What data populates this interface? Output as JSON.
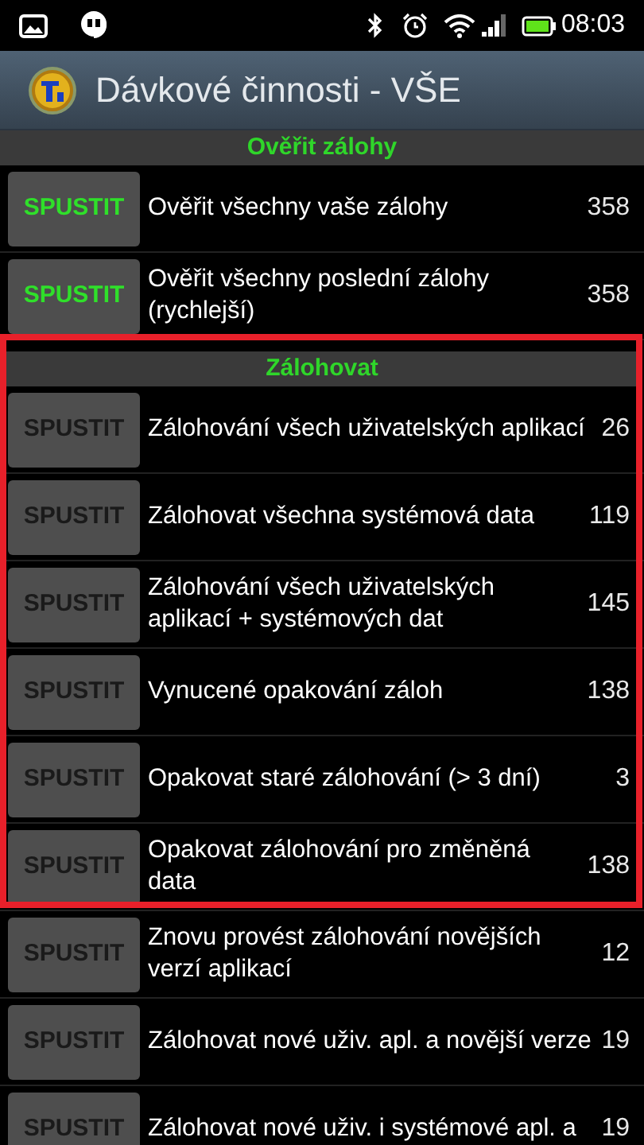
{
  "status_bar": {
    "time": "08:03"
  },
  "action_bar": {
    "title": "Dávkové činnosti - VŠE"
  },
  "sections": [
    {
      "title": "Ověřit zálohy",
      "items": [
        {
          "button": "SPUSTIT",
          "highlighted": true,
          "label": "Ověřit všechny vaše zálohy",
          "count": "358"
        },
        {
          "button": "SPUSTIT",
          "highlighted": true,
          "label": "Ověřit všechny poslední zálohy (rychlejší)",
          "count": "358"
        }
      ]
    },
    {
      "title": "Zálohovat",
      "items": [
        {
          "button": "SPUSTIT",
          "highlighted": false,
          "label": "Zálohování všech uživatelských aplikací",
          "count": "26"
        },
        {
          "button": "SPUSTIT",
          "highlighted": false,
          "label": "Zálohovat všechna systémová data",
          "count": "119"
        },
        {
          "button": "SPUSTIT",
          "highlighted": false,
          "label": "Zálohování všech uživatelských aplikací + systémových dat",
          "count": "145"
        },
        {
          "button": "SPUSTIT",
          "highlighted": false,
          "label": "Vynucené opakování záloh",
          "count": "138"
        },
        {
          "button": "SPUSTIT",
          "highlighted": false,
          "label": "Opakovat staré zálohování (> 3 dní)",
          "count": "3"
        },
        {
          "button": "SPUSTIT",
          "highlighted": false,
          "label": "Opakovat zálohování pro změněná data",
          "count": "138"
        },
        {
          "button": "SPUSTIT",
          "highlighted": false,
          "label": "Znovu provést zálohování novějších verzí aplikací",
          "count": "12"
        },
        {
          "button": "SPUSTIT",
          "highlighted": false,
          "label": "Zálohovat nové uživ. apl. a novější verze",
          "count": "19"
        },
        {
          "button": "SPUSTIT",
          "highlighted": false,
          "label": "Zálohovat nové uživ. i systémové apl. a",
          "count": "19"
        }
      ]
    }
  ]
}
